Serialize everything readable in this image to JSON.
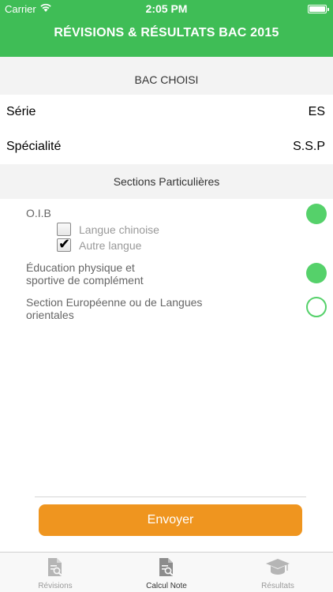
{
  "status_bar": {
    "carrier": "Carrier",
    "time": "2:05 PM"
  },
  "app": {
    "title": "RÉVISIONS & RÉSULTATS BAC 2015",
    "accent_color": "#3fbd56",
    "button_color": "#ef951f"
  },
  "bac_section": {
    "header": "BAC CHOISI",
    "rows": [
      {
        "label": "Série",
        "value": "ES"
      },
      {
        "label": "Spécialité",
        "value": "S.S.P"
      }
    ]
  },
  "special_sections": {
    "header": "Sections Particulières",
    "oib": {
      "label": "O.I.B",
      "enabled": true,
      "languages": [
        {
          "label": "Langue chinoise",
          "checked": false
        },
        {
          "label": "Autre langue",
          "checked": true
        }
      ]
    },
    "eps": {
      "label_line1": "Éducation physique et",
      "label_line2": "sportive de complément",
      "enabled": true
    },
    "euro": {
      "label_line1": "Section Européenne ou de Langues",
      "label_line2": "orientales",
      "enabled": false
    }
  },
  "send_button": {
    "label": "Envoyer"
  },
  "tabs": [
    {
      "label": "Révisions",
      "icon": "document-search-icon",
      "active": false
    },
    {
      "label": "Calcul Note",
      "icon": "document-search-icon",
      "active": true
    },
    {
      "label": "Résultats",
      "icon": "graduation-cap-icon",
      "active": false
    }
  ]
}
